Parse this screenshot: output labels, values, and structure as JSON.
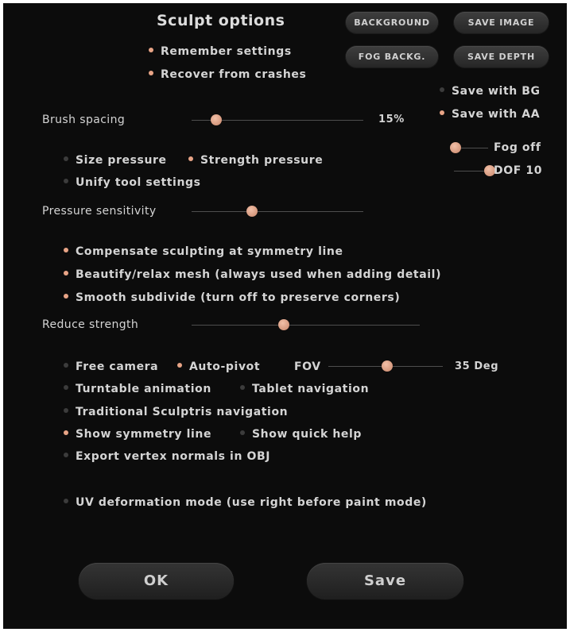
{
  "title": "Sculpt options",
  "colors": {
    "accent": "#e8a486",
    "off": "#3c3c3c",
    "panel": "#0c0c0c"
  },
  "buttons": {
    "background": "BACKGROUND",
    "save_image": "SAVE IMAGE",
    "fog_background": "FOG BACKG.",
    "save_depth": "SAVE DEPTH",
    "ok": "OK",
    "save": "Save"
  },
  "options": {
    "remember_settings": {
      "label": "Remember settings",
      "on": true
    },
    "recover_from_crashes": {
      "label": "Recover from crashes",
      "on": true
    },
    "save_with_bg": {
      "label": "Save with BG",
      "on": false
    },
    "save_with_aa": {
      "label": "Save with AA",
      "on": true
    },
    "size_pressure": {
      "label": "Size pressure",
      "on": false
    },
    "strength_pressure": {
      "label": "Strength pressure",
      "on": true
    },
    "unify_tool_settings": {
      "label": "Unify tool settings",
      "on": false
    },
    "compensate_symmetry": {
      "label": "Compensate sculpting at symmetry line",
      "on": true
    },
    "beautify_mesh": {
      "label": "Beautify/relax mesh (always used when adding detail)",
      "on": true
    },
    "smooth_subdivide": {
      "label": "Smooth subdivide (turn off to preserve corners)",
      "on": true
    },
    "free_camera": {
      "label": "Free camera",
      "on": false
    },
    "auto_pivot": {
      "label": "Auto-pivot",
      "on": true
    },
    "turntable_animation": {
      "label": "Turntable animation",
      "on": false
    },
    "tablet_navigation": {
      "label": "Tablet navigation",
      "on": false
    },
    "traditional_navigation": {
      "label": "Traditional Sculptris navigation",
      "on": false
    },
    "show_symmetry_line": {
      "label": "Show symmetry line",
      "on": true
    },
    "show_quick_help": {
      "label": "Show quick help",
      "on": false
    },
    "export_vertex_normals": {
      "label": "Export vertex normals in OBJ",
      "on": false
    },
    "uv_deformation": {
      "label": "UV deformation mode (use right before paint mode)",
      "on": false
    }
  },
  "sliders": {
    "brush_spacing": {
      "label": "Brush spacing",
      "value_text": "15%",
      "level": 0.14
    },
    "pressure_sensitivity": {
      "label": "Pressure sensitivity",
      "level": 0.35
    },
    "reduce_strength": {
      "label": "Reduce strength",
      "level": 0.4
    },
    "fov": {
      "label": "FOV",
      "value_text": "35 Deg",
      "level": 0.5
    },
    "fog": {
      "label": "Fog off",
      "level": 0.0
    },
    "dof": {
      "label": "DOF 10",
      "level": 1.0
    }
  }
}
